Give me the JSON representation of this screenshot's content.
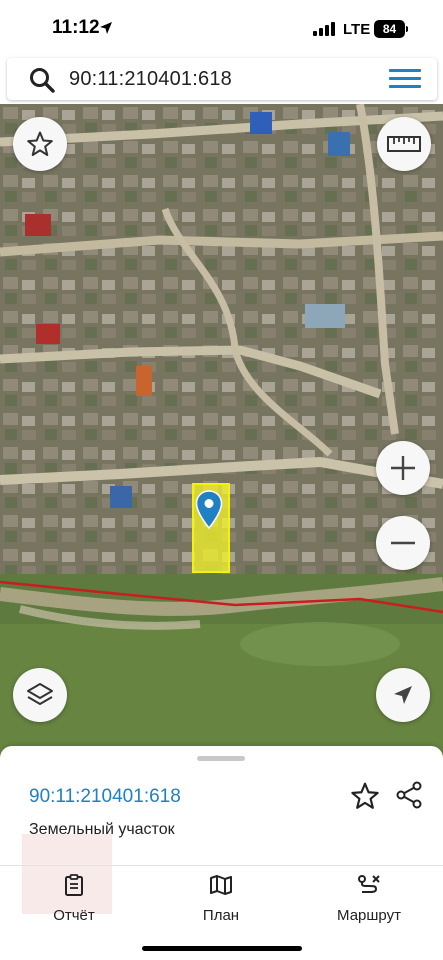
{
  "status": {
    "time": "11:12",
    "network": "LTE",
    "battery": "84"
  },
  "search": {
    "query": "90:11:210401:618"
  },
  "map": {
    "parcel_color": "#f5f52a",
    "boundary_color": "#c81e1e",
    "marker_color": "#1f80c4"
  },
  "sheet": {
    "title": "90:11:210401:618",
    "subtitle": "Земельный участок"
  },
  "tabs": [
    {
      "label": "Отчёт",
      "icon": "report-icon"
    },
    {
      "label": "План",
      "icon": "map-plan-icon"
    },
    {
      "label": "Маршрут",
      "icon": "route-icon"
    }
  ],
  "colors": {
    "accent": "#1f80c4"
  }
}
